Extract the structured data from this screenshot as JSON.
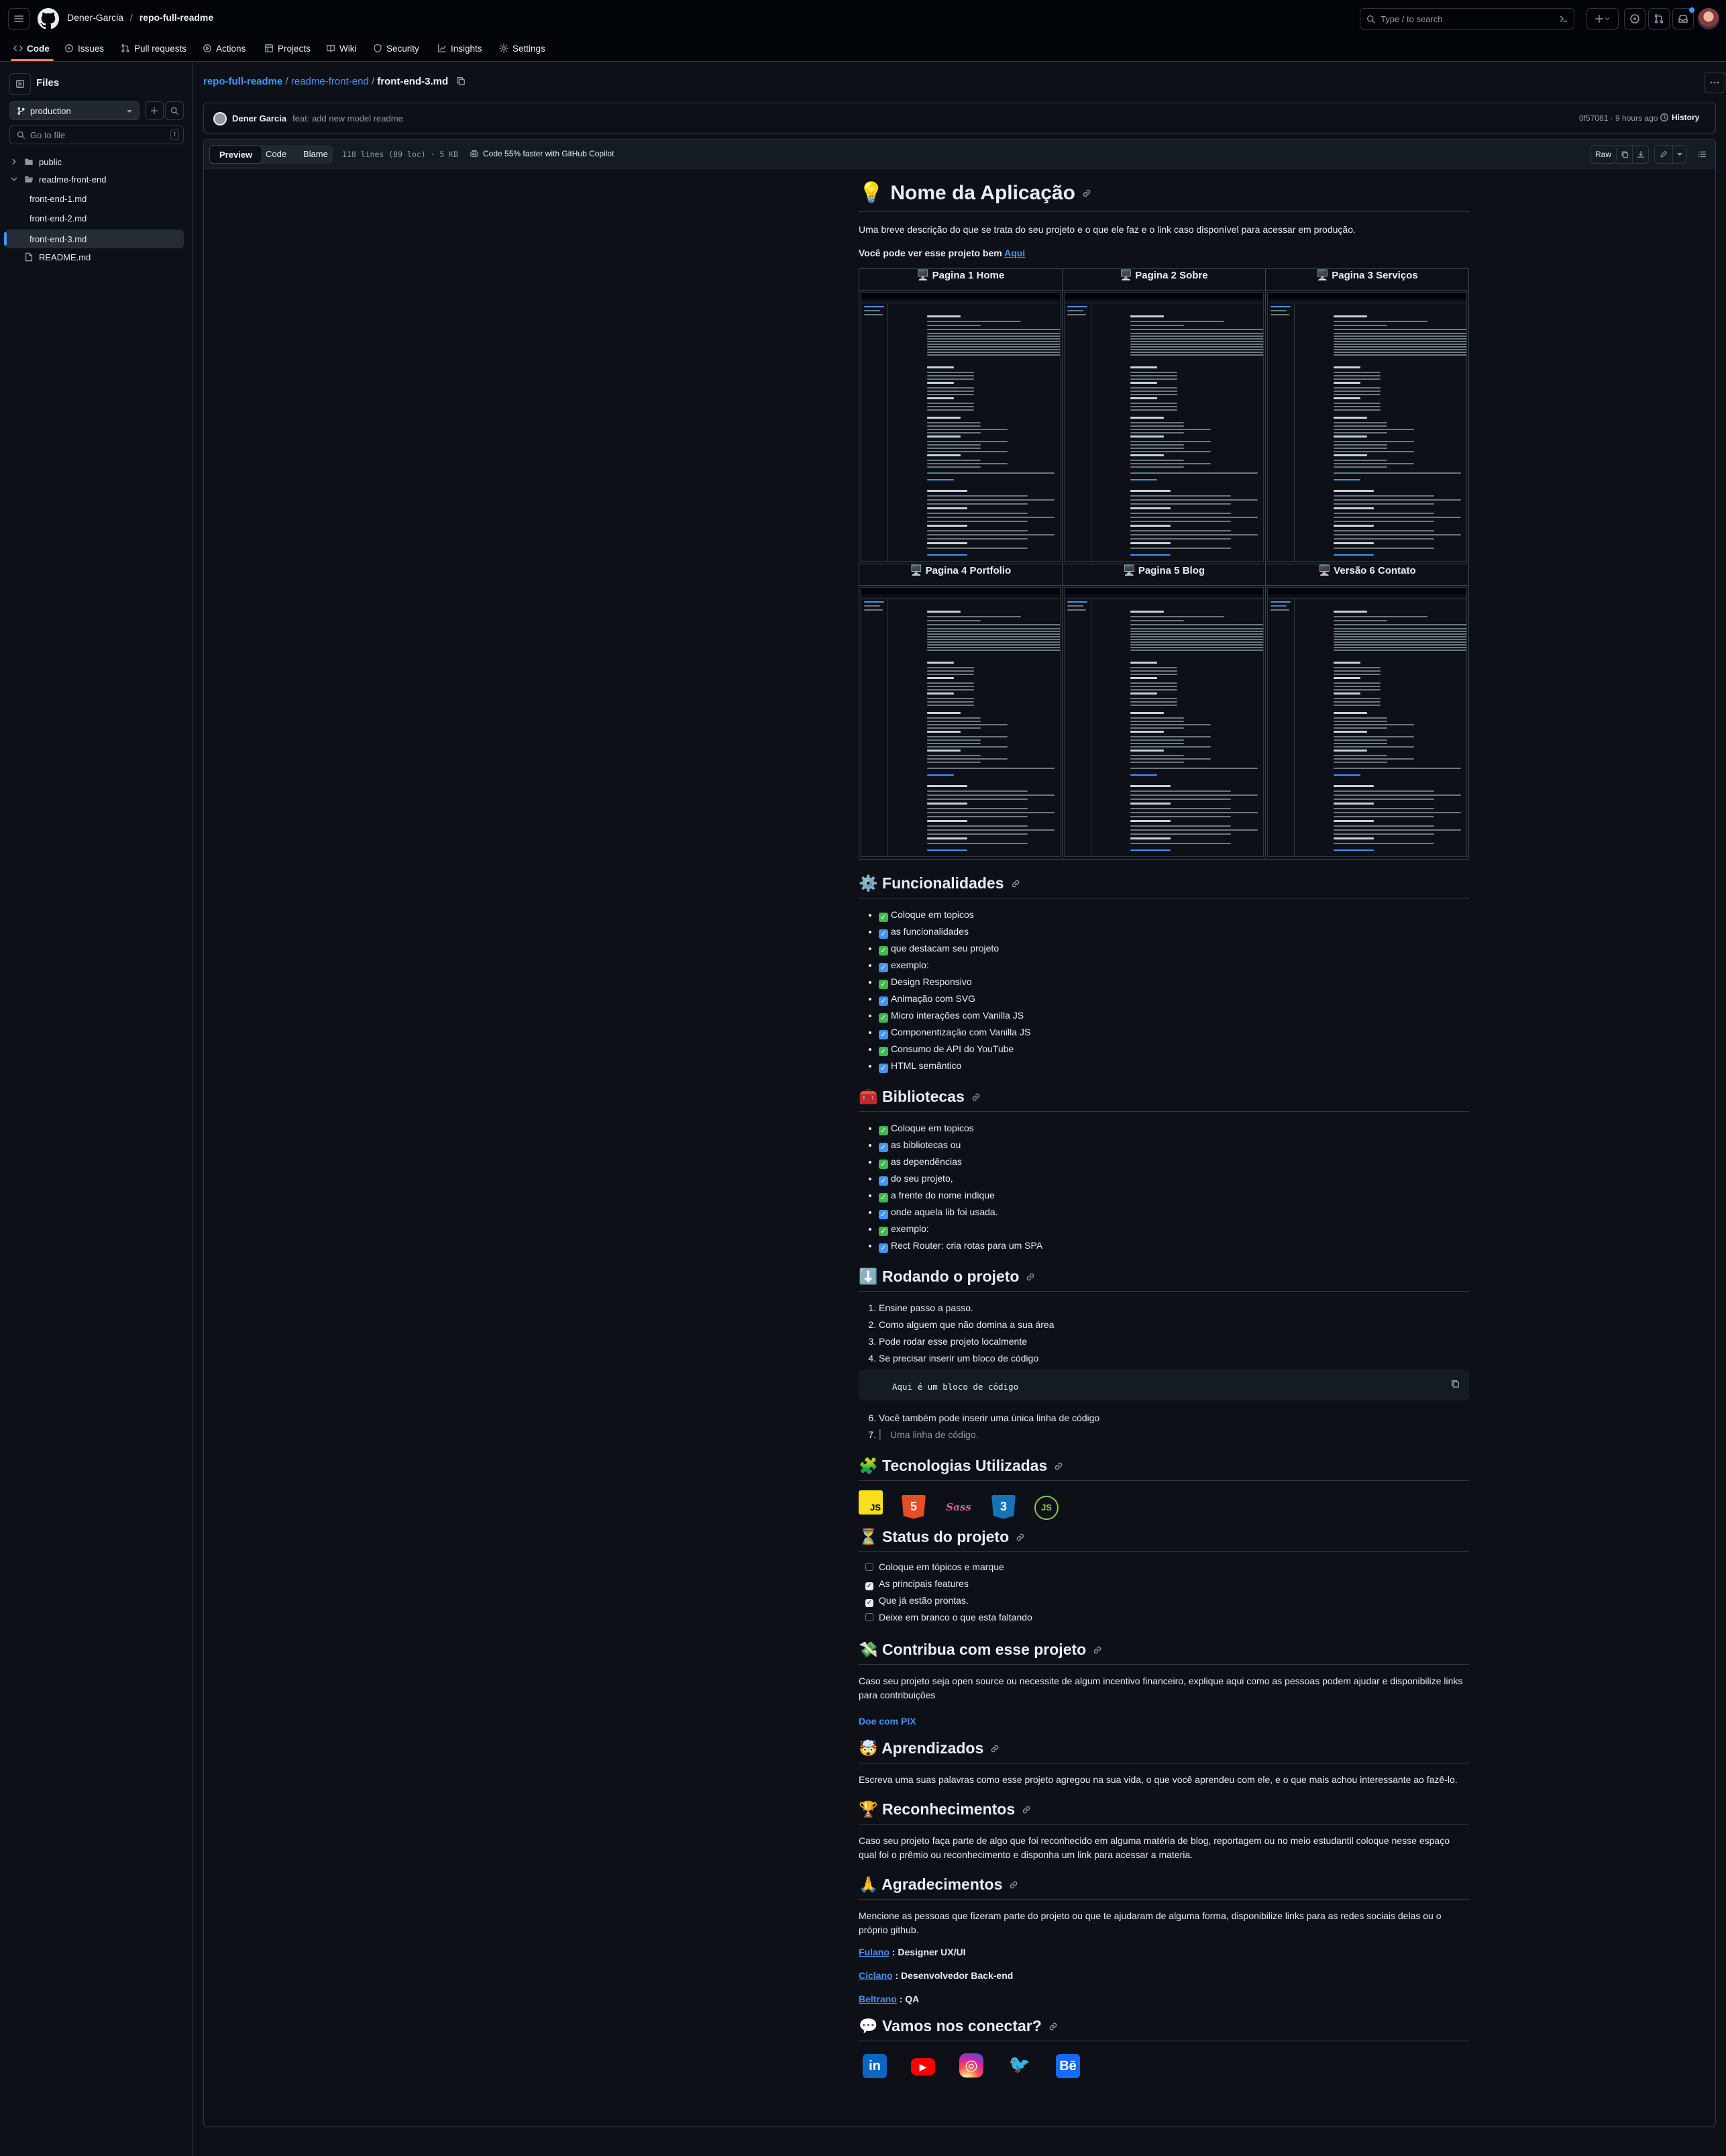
{
  "header": {
    "owner": "Dener-Garcia",
    "separator": "/",
    "repo": "repo-full-readme",
    "search_placeholder": "Type / to search"
  },
  "nav": [
    {
      "label": "Code",
      "icon": "code-icon"
    },
    {
      "label": "Issues",
      "icon": "issue-icon"
    },
    {
      "label": "Pull requests",
      "icon": "pull-request-icon"
    },
    {
      "label": "Actions",
      "icon": "play-icon"
    },
    {
      "label": "Projects",
      "icon": "table-icon"
    },
    {
      "label": "Wiki",
      "icon": "book-icon"
    },
    {
      "label": "Security",
      "icon": "shield-icon"
    },
    {
      "label": "Insights",
      "icon": "graph-icon"
    },
    {
      "label": "Settings",
      "icon": "gear-icon"
    }
  ],
  "sidebar": {
    "title": "Files",
    "branch": "production",
    "filter_placeholder": "Go to file",
    "filter_shortcut": "t",
    "tree": [
      {
        "label": "public",
        "type": "folder"
      },
      {
        "label": "readme-front-end",
        "type": "folder-open"
      },
      {
        "label": "front-end-1.md",
        "type": "file"
      },
      {
        "label": "front-end-2.md",
        "type": "file"
      },
      {
        "label": "front-end-3.md",
        "type": "file",
        "selected": true
      },
      {
        "label": "README.md",
        "type": "file"
      }
    ]
  },
  "breadcrumb": {
    "repo": "repo-full-readme",
    "folder": "readme-front-end",
    "file": "front-end-3.md",
    "sep": "/"
  },
  "commit": {
    "author": "Dener Garcia",
    "message": "feat: add new model readme",
    "sha": "0f57081 · 9 hours ago",
    "history_label": "History"
  },
  "filebar": {
    "tabs": [
      "Preview",
      "Code",
      "Blame"
    ],
    "meta": "118 lines (89 loc) · 5 KB",
    "copilot": "Code 55% faster with GitHub Copilot",
    "raw_label": "Raw"
  },
  "readme": {
    "title_emoji": "💡",
    "title": "Nome da Aplicação",
    "intro": "Uma breve descrição do que se trata do seu projeto e o que ele faz e o link caso disponível para acessar em produção.",
    "see_text": "Você pode ver esse projeto bem",
    "see_link": "Aqui",
    "gallery": [
      [
        "🖥️ Pagina 1 Home",
        "🖥️ Pagina 2 Sobre",
        "🖥️ Pagina 3 Serviços"
      ],
      [
        "🖥️ Pagina 4 Portfolio",
        "🖥️ Pagina 5 Blog",
        "🖥️ Versão 6 Contato"
      ]
    ],
    "func_title": "⚙️ Funcionalidades",
    "func_items": [
      {
        "mark": "g",
        "text": "Coloque em topicos"
      },
      {
        "mark": "b",
        "text": "as funcionalidades"
      },
      {
        "mark": "g",
        "text": "que destacam seu projeto"
      },
      {
        "mark": "b",
        "text": "exemplo:"
      },
      {
        "mark": "g",
        "text": "Design Responsivo"
      },
      {
        "mark": "b",
        "text": "Animação com SVG"
      },
      {
        "mark": "g",
        "text": "Micro interações com Vanilla JS"
      },
      {
        "mark": "b",
        "text": "Componentização com Vanilla JS"
      },
      {
        "mark": "g",
        "text": "Consumo de API do YouTube"
      },
      {
        "mark": "b",
        "text": "HTML semântico"
      }
    ],
    "lib_title": "🧰 Bibliotecas",
    "lib_items": [
      {
        "mark": "g",
        "text": "Coloque em topicos"
      },
      {
        "mark": "b",
        "text": "as bibliotecas ou"
      },
      {
        "mark": "g",
        "text": "as dependências"
      },
      {
        "mark": "b",
        "text": "do seu projeto,"
      },
      {
        "mark": "g",
        "text": "a frente do nome indique"
      },
      {
        "mark": "b",
        "text": "onde aquela lib foi usada."
      },
      {
        "mark": "g",
        "text": "exemplo:"
      },
      {
        "mark": "b",
        "text": "Rect Router: cria rotas para um SPA"
      }
    ],
    "run_title": "⬇️ Rodando o projeto",
    "run_items": [
      "Ensine passo a passo.",
      "Como alguem que não domina a sua área",
      "Pode rodar esse projeto localmente",
      "Se precisar inserir um bloco de código"
    ],
    "code_block": "Aqui é um bloco de código",
    "run_item6": "Você também pode inserir uma única linha de código",
    "run_item7": "Uma linha de código.",
    "tech_title": "🧩 Tecnologias Utilizadas",
    "tech_badges": [
      {
        "name": "javascript-icon",
        "label": "JS",
        "color": "#f7df1e"
      },
      {
        "name": "html5-icon",
        "label": "5",
        "color": "#e34f26"
      },
      {
        "name": "sass-icon",
        "label": "Sass",
        "color": "#cc6699"
      },
      {
        "name": "css3-icon",
        "label": "3",
        "color": "#1572b6"
      },
      {
        "name": "nodejs-icon",
        "label": "JS",
        "color": "#8cc84b"
      }
    ],
    "status_title": "⏳ Status do projeto",
    "status_items": [
      {
        "checked": false,
        "text": "Coloque em tópicos e marque"
      },
      {
        "checked": true,
        "text": "As principais features"
      },
      {
        "checked": true,
        "text": "Que já estão prontas."
      },
      {
        "checked": false,
        "text": "Deixe em branco o que esta faltando"
      }
    ],
    "contrib_title": "💸 Contribua com esse projeto",
    "contrib_text": "Caso seu projeto seja open source ou necessite de algum incentivo financeiro, explique aqui como as pessoas podem ajudar e disponibilize links para contribuições",
    "contrib_link": "Doe com PIX",
    "learn_title": "🤯 Aprendizados",
    "learn_text": "Escreva uma suas palavras como esse projeto agregou na sua vida, o que você aprendeu com ele, e o que mais achou interessante ao fazê-lo.",
    "recog_title": "🏆 Reconhecimentos",
    "recog_text": "Caso seu projeto faça parte de algo que foi reconhecido em alguma matéria de blog, reportagem ou no meio estudantil coloque nesse espaço qual foi o prêmio ou reconhecimento e disponha um link para acessar a materia.",
    "thanks_title": "🙏 Agradecimentos",
    "thanks_text": "Mencione as pessoas que fizeram parte do projeto ou que te ajudaram de alguma forma, disponibilize links para as redes sociais delas ou o próprio github.",
    "people": [
      {
        "name": "Fulano",
        "role": ": Designer UX/UI"
      },
      {
        "name": "Ciclano",
        "role": ": Desenvolvedor Back-end"
      },
      {
        "name": "Beltrano",
        "role": ": QA"
      }
    ],
    "connect_title": "💬 Vamos nos conectar?",
    "social": [
      {
        "name": "linkedin-icon",
        "label": "in",
        "color": "#0a66c2"
      },
      {
        "name": "youtube-icon",
        "label": "▶",
        "color": "#ff0000"
      },
      {
        "name": "instagram-icon",
        "label": "◎",
        "color": "#d6249f"
      },
      {
        "name": "twitter-icon",
        "label": "🐦",
        "color": "#1da1f2"
      },
      {
        "name": "behance-icon",
        "label": "Bē",
        "color": "#1769ff"
      }
    ]
  }
}
